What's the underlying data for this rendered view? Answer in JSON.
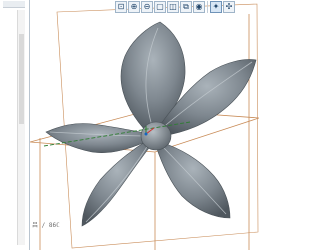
{
  "toolbar": {
    "buttons": [
      {
        "name": "zoom-fit-icon",
        "glyph": "⊡"
      },
      {
        "name": "zoom-in-icon",
        "glyph": "⊕"
      },
      {
        "name": "zoom-out-icon",
        "glyph": "⊖"
      },
      {
        "name": "zoom-window-icon",
        "glyph": "▢"
      },
      {
        "name": "repaint-icon",
        "glyph": "◫"
      },
      {
        "name": "saved-views-icon",
        "glyph": "⧉"
      },
      {
        "name": "display-style-icon",
        "glyph": "◉"
      },
      {
        "name": "datum-display-icon",
        "glyph": "✦"
      },
      {
        "name": "spin-center-icon",
        "glyph": "✣"
      }
    ]
  },
  "viewport": {
    "coordinate_label": "吕 / 86ℂ",
    "model_color": "#7e878f",
    "datum_plane_color": "#c98c58",
    "axis_color": "#2e7d32"
  }
}
